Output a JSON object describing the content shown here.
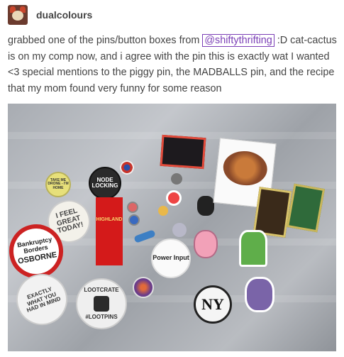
{
  "post": {
    "username": "dualcolours",
    "caption_before": "grabbed one of the  pins/button boxes from ",
    "mention": "@shiftythrifting",
    "caption_after": " :D cat-cactus is on my comp now, and i agree with the pin this is exactly wat I wanted <3 special mentions to the piggy pin, the MADBALLS pin, and the recipe that my mom found very funny for some reason"
  },
  "photo": {
    "pins": {
      "take_me": "TAKE ME DRONE - I'M HOME",
      "node_locking": "NODE LOCKING",
      "ribbon": "HIGHLAND",
      "feel_great": "I FEEL GREAT TODAY!",
      "bankruptcy": "Bankruptcy Borders",
      "osborne": "OSBORNE",
      "exactly": "EXACTLY WHAT YOU HAD IN MIND",
      "lootcrate": "LOOTCRATE",
      "lootpins": "#LOOTPINS",
      "power_input": "Power Input",
      "ny": "NY"
    }
  },
  "colors": {
    "mention": "#7b3fb6",
    "text": "#444444"
  }
}
